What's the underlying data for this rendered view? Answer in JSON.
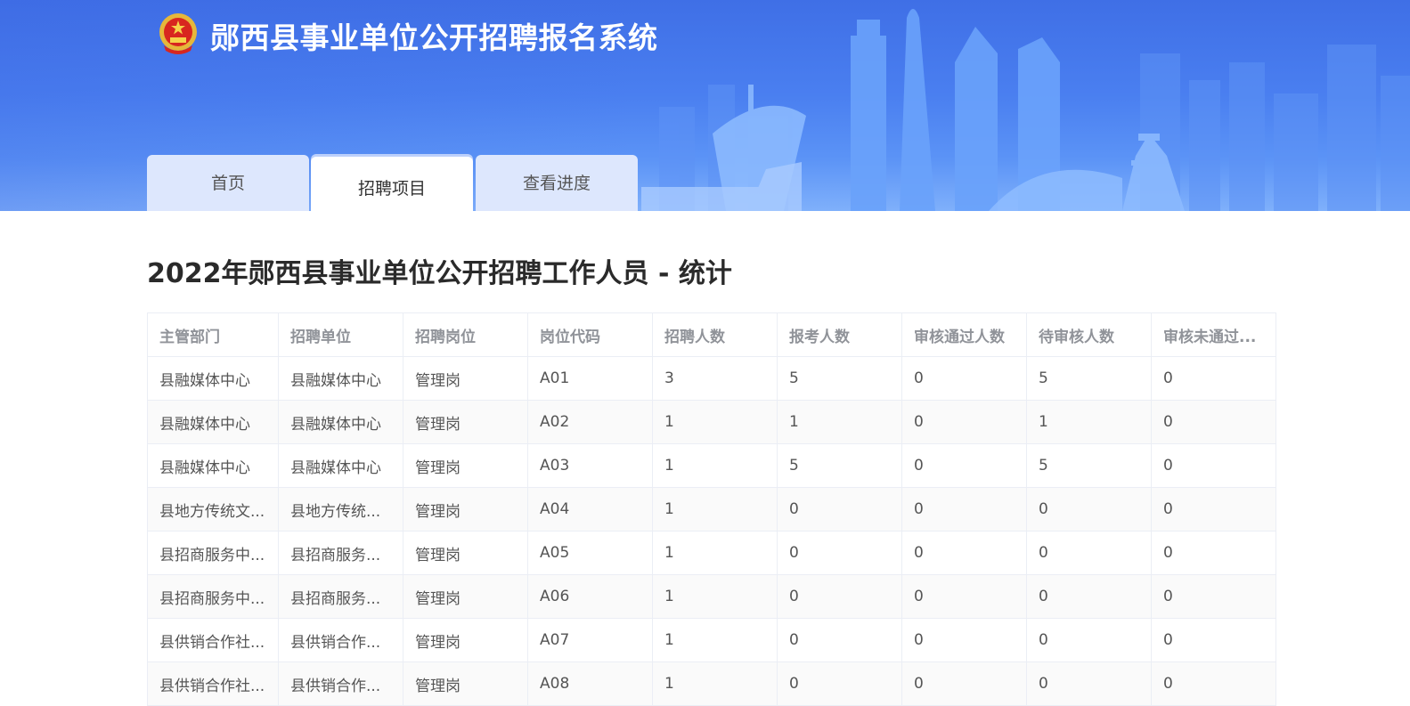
{
  "header": {
    "site_title": "郧西县事业单位公开招聘报名系统",
    "logo_icon": "national-emblem-icon",
    "accent_color": "#4a7ff0"
  },
  "tabs": [
    {
      "label": "首页",
      "active": false
    },
    {
      "label": "招聘项目",
      "active": true
    },
    {
      "label": "查看进度",
      "active": false
    }
  ],
  "main": {
    "page_title": "2022年郧西县事业单位公开招聘工作人员 - 统计"
  },
  "table": {
    "columns": [
      "主管部门",
      "招聘单位",
      "招聘岗位",
      "岗位代码",
      "招聘人数",
      "报考人数",
      "审核通过人数",
      "待审核人数",
      "审核未通过..."
    ],
    "rows": [
      [
        "县融媒体中心",
        "县融媒体中心",
        "管理岗",
        "A01",
        "3",
        "5",
        "0",
        "5",
        "0"
      ],
      [
        "县融媒体中心",
        "县融媒体中心",
        "管理岗",
        "A02",
        "1",
        "1",
        "0",
        "1",
        "0"
      ],
      [
        "县融媒体中心",
        "县融媒体中心",
        "管理岗",
        "A03",
        "1",
        "5",
        "0",
        "5",
        "0"
      ],
      [
        "县地方传统文...",
        "县地方传统...",
        "管理岗",
        "A04",
        "1",
        "0",
        "0",
        "0",
        "0"
      ],
      [
        "县招商服务中...",
        "县招商服务...",
        "管理岗",
        "A05",
        "1",
        "0",
        "0",
        "0",
        "0"
      ],
      [
        "县招商服务中...",
        "县招商服务...",
        "管理岗",
        "A06",
        "1",
        "0",
        "0",
        "0",
        "0"
      ],
      [
        "县供销合作社...",
        "县供销合作...",
        "管理岗",
        "A07",
        "1",
        "0",
        "0",
        "0",
        "0"
      ],
      [
        "县供销合作社...",
        "县供销合作...",
        "管理岗",
        "A08",
        "1",
        "0",
        "0",
        "0",
        "0"
      ]
    ]
  }
}
